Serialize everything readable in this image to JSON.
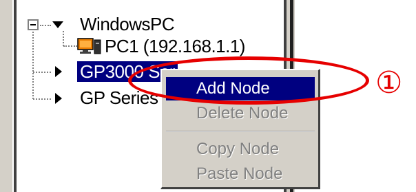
{
  "tree": {
    "root": {
      "label": "WindowsPC",
      "icon": "expander-minus-icon"
    },
    "items": [
      {
        "label": "PC1 (192.168.1.1)",
        "icon": "computer-icon"
      },
      {
        "label": "GP3000 Ser",
        "icon": "collapsed-arrow-icon",
        "selected": true
      },
      {
        "label": "GP Series",
        "icon": "collapsed-arrow-icon"
      }
    ]
  },
  "context_menu": {
    "items": [
      {
        "label": "Add Node",
        "state": "highlighted"
      },
      {
        "label": "Delete Node",
        "state": "disabled"
      },
      {
        "label": "Copy Node",
        "state": "disabled"
      },
      {
        "label": "Paste Node",
        "state": "disabled"
      }
    ]
  },
  "annotation": {
    "callout": "①",
    "color": "#e60000"
  },
  "colors": {
    "selection": "#000080",
    "menu_bg": "#d4d0c8",
    "disabled_text": "#808080"
  }
}
